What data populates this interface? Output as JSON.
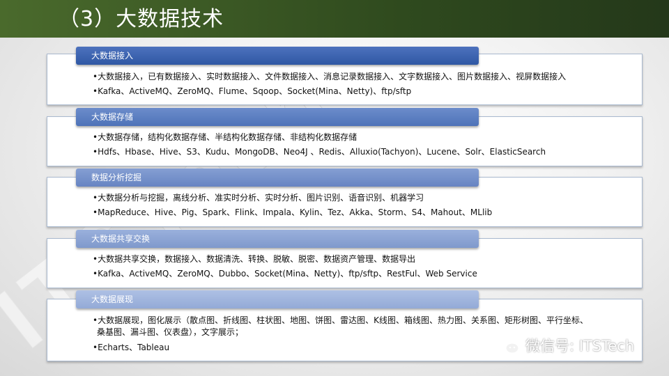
{
  "title": "（3）大数据技术",
  "watermark": "ITSTech",
  "footer": {
    "brand": "微信号: ITSTech"
  },
  "sections": [
    {
      "header": "大数据接入",
      "lines": [
        "•大数据接入，已有数据接入、实时数据接入、文件数据接入、消息记录数据接入、文字数据接入、图片数据接入、视屏数据接入",
        "•Kafka、ActiveMQ、ZeroMQ、Flume、Sqoop、Socket(Mina、Netty)、ftp/sftp"
      ]
    },
    {
      "header": "大数据存储",
      "lines": [
        "•大数据存储，结构化数据存储、半结构化数据存储、非结构化数据存储",
        "•Hdfs、Hbase、Hive、S3、Kudu、MongoDB、Neo4J 、Redis、Alluxio(Tachyon)、Lucene、Solr、ElasticSearch"
      ]
    },
    {
      "header": "数据分析挖掘",
      "lines": [
        "•大数据分析与挖掘，离线分析、准实时分析、实时分析、图片识别、语音识别、机器学习",
        "•MapReduce、Hive、Pig、Spark、Flink、Impala、Kylin、Tez、Akka、Storm、S4、Mahout、MLlib"
      ]
    },
    {
      "header": "大数据共享交换",
      "lines": [
        "•大数据共享交换，数据接入、数据清洗、转换、脱敏、脱密、数据资产管理、数据导出",
        "•Kafka、ActiveMQ、ZeroMQ、Dubbo、Socket(Mina、Netty)、ftp/sftp、RestFul、Web Service"
      ]
    },
    {
      "header": "大数据展现",
      "lines": [
        "•大数据展现，图化展示（散点图、折线图、柱状图、地图、饼图、雷达图、K线图、箱线图、热力图、关系图、矩形树图、平行坐标、",
        "桑基图、漏斗图、仪表盘），文字展示；",
        "•Echarts、Tableau"
      ]
    }
  ],
  "colors": {
    "header_gradient": [
      "#3a62ad",
      "#5b7fc1",
      "#7895cc",
      "#8ea7d4",
      "#9fb4dc"
    ]
  }
}
